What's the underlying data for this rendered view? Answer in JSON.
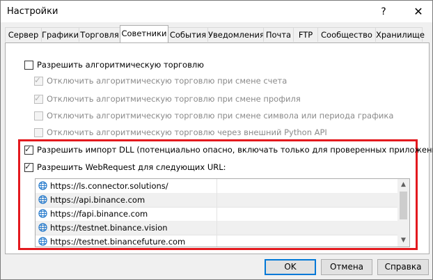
{
  "window": {
    "title": "Настройки",
    "help_glyph": "?",
    "close_glyph": "✕"
  },
  "tabs": [
    "Сервер",
    "Графики",
    "Торговля",
    "Советники",
    "События",
    "Уведомления",
    "Почта",
    "FTP",
    "Сообщество",
    "Хранилище"
  ],
  "active_tab": "Советники",
  "options": {
    "allow_algo": {
      "label": "Разрешить алгоритмическую торговлю",
      "checked": false,
      "enabled": true
    },
    "disable_on_account": {
      "label": "Отключить алгоритмическую торговлю при смене счета",
      "checked": true,
      "enabled": false
    },
    "disable_on_profile": {
      "label": "Отключить алгоритмическую торговлю при смене профиля",
      "checked": true,
      "enabled": false
    },
    "disable_on_symbol": {
      "label": "Отключить алгоритмическую торговлю при смене символа или периода графика",
      "checked": false,
      "enabled": false
    },
    "disable_python": {
      "label": "Отключить алгоритмическую торговлю через внешний Python API",
      "checked": false,
      "enabled": false
    },
    "allow_dll": {
      "label": "Разрешить импорт DLL (потенциально опасно, включать только для проверенных приложений)",
      "checked": true,
      "enabled": true
    },
    "allow_webrequest": {
      "label": "Разрешить WebRequest для следующих URL:",
      "checked": true,
      "enabled": true
    }
  },
  "urls": [
    "https://ls.connector.solutions/",
    "https://api.binance.com",
    "https://fapi.binance.com",
    "https://testnet.binance.vision",
    "https://testnet.binancefuture.com"
  ],
  "buttons": {
    "ok": "OK",
    "cancel": "Отмена",
    "help": "Справка"
  },
  "colors": {
    "highlight_border": "#e3191e",
    "default_button_border": "#0078d7",
    "globe": "#1a73c9"
  },
  "tick_glyph": "✓"
}
